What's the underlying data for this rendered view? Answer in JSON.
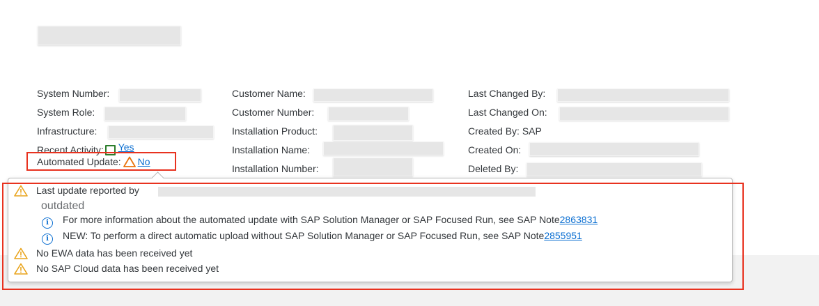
{
  "header": {
    "title_redacted": true
  },
  "col1": [
    {
      "label": "System Number:",
      "value_redacted": true
    },
    {
      "label": "System Role:",
      "value_redacted": true
    },
    {
      "label": "Infrastructure:",
      "value_redacted": true
    },
    {
      "label": "Recent Activity:",
      "link": "Yes",
      "icon": "green-square-icon"
    },
    {
      "label": "Automated Update:",
      "link": "No",
      "icon": "warning-triangle-icon"
    }
  ],
  "col2": [
    {
      "label": "Customer Name:"
    },
    {
      "label": "Customer Number:"
    },
    {
      "label": "Installation Product:"
    },
    {
      "label": "Installation Name:"
    },
    {
      "label": "Installation Number:"
    }
  ],
  "col3": [
    {
      "label": "Last Changed By:"
    },
    {
      "label": "Last Changed On:"
    },
    {
      "label": "Created By:",
      "value": "SAP"
    },
    {
      "label": "Created On:"
    },
    {
      "label": "Deleted By:"
    }
  ],
  "popover": {
    "msg1": "Last update reported by",
    "status": "outdated",
    "info1_text": "For more information about the automated update with SAP Solution Manager or SAP Focused Run, see SAP Note",
    "info1_link": "2863831",
    "info2_text": "NEW: To perform a direct automatic upload without SAP Solution Manager or SAP Focused Run, see SAP Note",
    "info2_link": "2855951",
    "msg2": "No EWA data has been received yet",
    "msg3": "No SAP Cloud data has been received yet"
  },
  "colors": {
    "link": "#0a6ed1",
    "warning": "#e9730c",
    "highlight": "#e8321f",
    "success": "#2b7d2b"
  }
}
